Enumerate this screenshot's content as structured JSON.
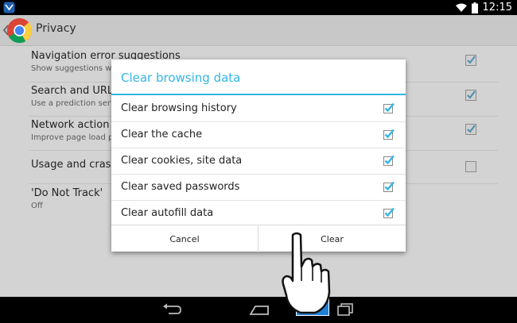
{
  "status_bar": {
    "time": "12:15"
  },
  "action_bar": {
    "title": "Privacy"
  },
  "settings": [
    {
      "title": "Navigation error suggestions",
      "summary": "Show suggestions whe",
      "checked": true
    },
    {
      "title": "Search and URL su",
      "summary": "Use a prediction servic",
      "checked": true
    },
    {
      "title": "Network action pre",
      "summary": "Improve page load perf",
      "checked": true
    },
    {
      "title": "Usage and crash r",
      "summary": "",
      "checked": false
    },
    {
      "title": "'Do Not Track'",
      "summary": "Off",
      "checked": null
    }
  ],
  "dialog": {
    "title": "Clear browsing data",
    "options": [
      {
        "label": "Clear browsing history",
        "checked": true
      },
      {
        "label": "Clear the cache",
        "checked": true
      },
      {
        "label": "Clear cookies, site data",
        "checked": true
      },
      {
        "label": "Clear saved passwords",
        "checked": true
      },
      {
        "label": "Clear autofill data",
        "checked": true
      }
    ],
    "cancel_label": "Cancel",
    "clear_label": "Clear"
  },
  "icons": {
    "status_left": "app-notification-icon",
    "wifi": "wifi-icon",
    "battery": "battery-icon",
    "nav_back": "back-icon",
    "nav_home": "home-icon",
    "nav_recents": "recent-apps-icon",
    "pointer": "pointing-hand-icon"
  },
  "colors": {
    "accent": "#33b5e5",
    "checkbox": "#33b5e5"
  }
}
